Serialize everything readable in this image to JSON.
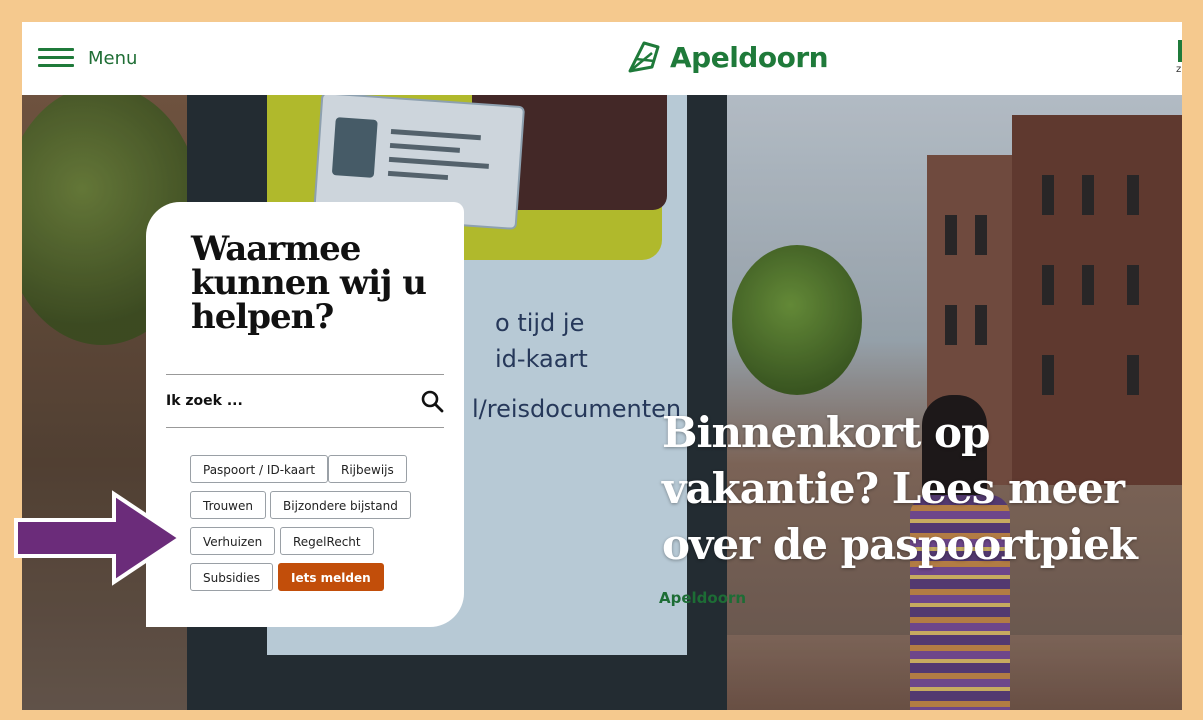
{
  "header": {
    "menu_label": "Menu",
    "logo_text": "Apeldoorn",
    "right_edge_text": "z",
    "brand_color": "#1f7a3a"
  },
  "hero": {
    "screen_lines": [
      "o tijd je",
      "id-kaart",
      "l/reisdocumenten"
    ],
    "screen_logo": "Apeldoorn",
    "headline": "Binnenkort op vakantie? Lees meer over de paspoortpiek"
  },
  "helper_card": {
    "title": "Waarmee kunnen wij u helpen?",
    "search": {
      "placeholder": "Ik zoek ...",
      "value": ""
    },
    "quick_links": [
      {
        "label": "Paspoort / ID-kaart",
        "style": "outline"
      },
      {
        "label": "Rijbewijs",
        "style": "outline"
      },
      {
        "label": "Trouwen",
        "style": "outline"
      },
      {
        "label": "Bijzondere bijstand",
        "style": "outline"
      },
      {
        "label": "Verhuizen",
        "style": "outline"
      },
      {
        "label": "RegelRecht",
        "style": "outline"
      },
      {
        "label": "Subsidies",
        "style": "outline"
      },
      {
        "label": "Iets melden",
        "style": "primary"
      }
    ],
    "primary_color": "#c24e0a"
  },
  "annotation": {
    "arrow_icon": "arrow-right-icon",
    "arrow_color": "#6b2c7a",
    "frame_color": "#f5c98e"
  }
}
